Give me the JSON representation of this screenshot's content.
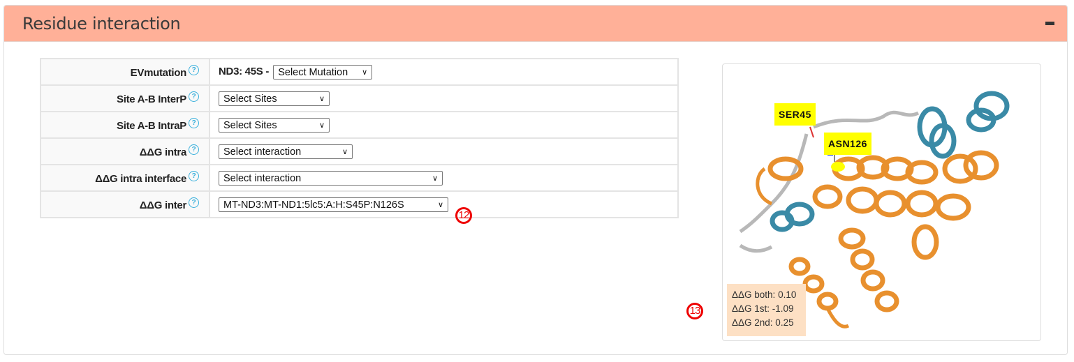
{
  "panel": {
    "title": "Residue interaction",
    "collapse_label": "−"
  },
  "options": {
    "rows": [
      {
        "label": "EVmutation",
        "prefix": "ND3: 45S -",
        "select": "Select Mutation"
      },
      {
        "label": "Site A-B InterP",
        "select": "Select Sites"
      },
      {
        "label": "Site A-B IntraP",
        "select": "Select Sites"
      },
      {
        "label": "ΔΔG intra",
        "select": "Select interaction"
      },
      {
        "label": "ΔΔG intra interface",
        "select": "Select interaction"
      },
      {
        "label": "ΔΔG inter",
        "select": "MT-ND3:MT-ND1:5lc5:A:H:S45P:N126S"
      }
    ],
    "help_glyph": "?"
  },
  "markers": {
    "m12": "12",
    "m13": "13"
  },
  "viewer": {
    "residue_labels": [
      "SER45",
      "ASN126"
    ],
    "colors": {
      "chain_a": "#e8902e",
      "chain_b": "#3a8aa6",
      "loop": "#b8b8b8",
      "highlight": "#ffff00"
    },
    "ddg": {
      "both": "ΔΔG both: 0.10",
      "first": "ΔΔG 1st: -1.09",
      "second": "ΔΔG 2nd: 0.25"
    }
  }
}
